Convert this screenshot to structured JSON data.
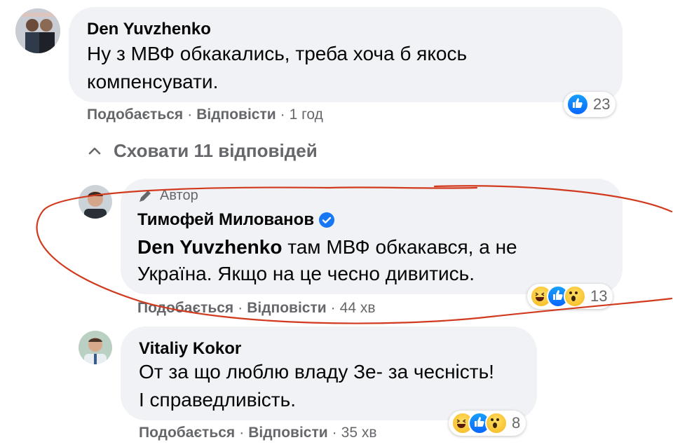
{
  "comment1": {
    "author": "Den Yuvzhenko",
    "text_line1": "Ну з МВФ обкакались, треба хоча б якось",
    "text_line2": "компенсувати.",
    "like": "Подобається",
    "reply": "Відповісти",
    "time": "1 год",
    "reaction_count": "23",
    "reaction_icons": [
      "like-icon"
    ]
  },
  "hide_replies": {
    "label": "Сховати 11 відповідей",
    "icon": "chevron-up-icon"
  },
  "reply1": {
    "badge": "Автор",
    "author": "Тимофей Милованов",
    "mention": "Den Yuvzhenko",
    "text_line1_rest": " там МВФ обкакався, а не",
    "text_line2": "Україна. Якщо на це чесно дивитись.",
    "like": "Подобається",
    "reply": "Відповісти",
    "time": "44 хв",
    "reaction_count": "13",
    "reaction_icons": [
      "haha-icon",
      "like-icon",
      "wow-icon"
    ]
  },
  "reply2": {
    "author": "Vitaliy Kokor",
    "text_line1": "От за що люблю владу Зе- за чесність!",
    "text_line2": "І справедливість.",
    "like": "Подобається",
    "reply": "Відповісти",
    "time": "35 хв",
    "reaction_count": "8",
    "reaction_icons": [
      "haha-icon",
      "like-icon",
      "wow-icon"
    ]
  },
  "colors": {
    "bubble": "#f0f2f5",
    "meta_text": "#65676b",
    "verified": "#1877f2",
    "annotation": "#d13a1e"
  }
}
